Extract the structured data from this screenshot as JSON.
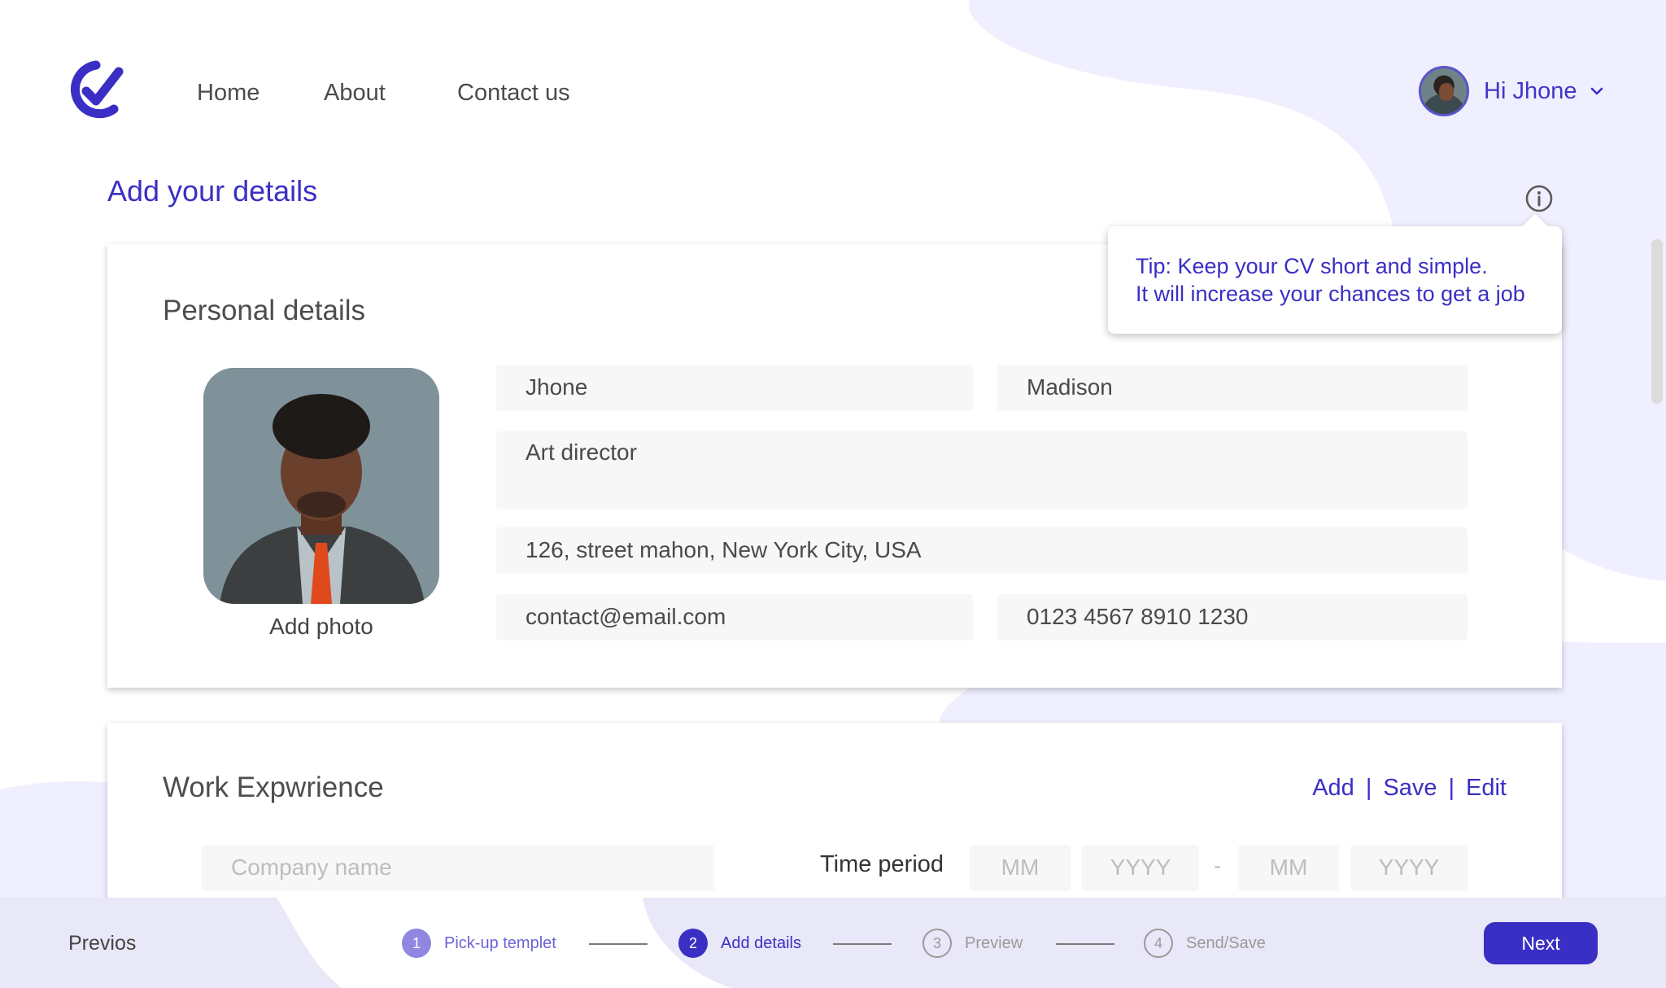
{
  "colors": {
    "accent": "#3a2fc4",
    "blob": "#efefff",
    "bottom_bar": "#e8e8f8"
  },
  "nav": {
    "items": [
      "Home",
      "About",
      "Contact us"
    ]
  },
  "user": {
    "greeting": "Hi Jhone"
  },
  "page_title": "Add your details",
  "tooltip": {
    "line1": "Tip: Keep your CV short and simple.",
    "line2": "It will increase your chances to get a job"
  },
  "personal": {
    "title": "Personal details",
    "add_photo": "Add photo",
    "first_name": "Jhone",
    "last_name": "Madison",
    "job_title": "Art director",
    "address": "126, street mahon, New York City, USA",
    "email": "contact@email.com",
    "phone": "0123 4567 8910 1230"
  },
  "work": {
    "title": "Work Expwrience",
    "actions": {
      "add": "Add",
      "sep": "|",
      "save": "Save",
      "edit": "Edit"
    },
    "company_placeholder": "Company name",
    "time_label": "Time period",
    "start_month": "MM",
    "start_year": "YYYY",
    "range_dash": "-",
    "end_month": "MM",
    "end_year": "YYYY"
  },
  "footer": {
    "prev": "Previos",
    "next": "Next",
    "steps": [
      {
        "num": "1",
        "label": "Pick-up templet",
        "state": "done"
      },
      {
        "num": "2",
        "label": "Add details",
        "state": "active"
      },
      {
        "num": "3",
        "label": "Preview",
        "state": "pending"
      },
      {
        "num": "4",
        "label": "Send/Save",
        "state": "pending"
      }
    ]
  }
}
